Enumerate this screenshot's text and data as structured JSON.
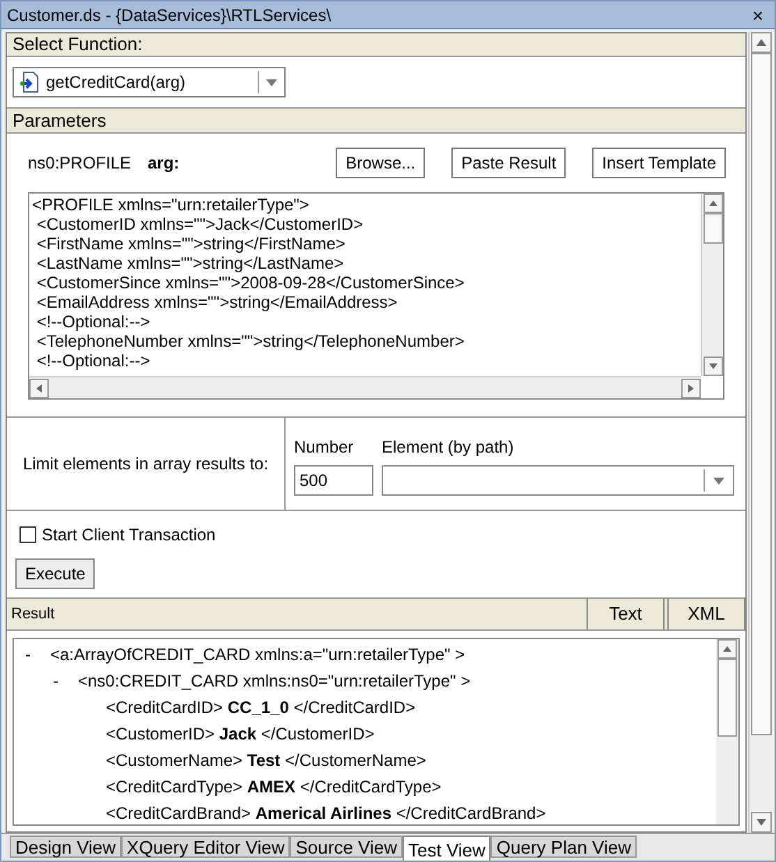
{
  "window": {
    "title": "Customer.ds - {DataServices}\\RTLServices\\",
    "close": "×"
  },
  "select_function": {
    "header": "Select Function:",
    "value": "getCreditCard(arg)"
  },
  "parameters": {
    "header": "Parameters",
    "type": "ns0:PROFILE",
    "name": "arg:",
    "buttons": [
      "Browse...",
      "Paste Result",
      "Insert Template"
    ],
    "lines": [
      "<PROFILE xmlns=\"urn:retailerType\">",
      " <CustomerID xmlns=\"\">Jack</CustomerID>",
      " <FirstName xmlns=\"\">string</FirstName>",
      " <LastName xmlns=\"\">string</LastName>",
      " <CustomerSince xmlns=\"\">2008-09-28</CustomerSince>",
      " <EmailAddress xmlns=\"\">string</EmailAddress>",
      " <!--Optional:-->",
      " <TelephoneNumber xmlns=\"\">string</TelephoneNumber>",
      " <!--Optional:-->"
    ]
  },
  "limit": {
    "label": "Limit elements in array results to:",
    "number_label": "Number",
    "number_value": "500",
    "element_label": "Element (by path)"
  },
  "start_client_transaction": {
    "label": "Start Client Transaction",
    "checked": false
  },
  "execute_button": "Execute",
  "result": {
    "header": "Result",
    "buttons": [
      {
        "label": "Text"
      },
      {
        "label": "XML"
      }
    ],
    "tree": [
      {
        "text": "<a:ArrayOfCREDIT_CARD xmlns:a=\"urn:retailerType\" >",
        "toggle": "-",
        "expanded": true,
        "children": [
          {
            "text": "<ns0:CREDIT_CARD xmlns:ns0=\"urn:retailerType\" >",
            "toggle": "-",
            "expanded": true,
            "children": [
              {
                "text": "<CreditCardID> **CC_1_0** </CreditCardID>"
              },
              {
                "text": "<CustomerID> **Jack** </CustomerID>"
              },
              {
                "text": "<CustomerName> **Test** </CustomerName>"
              },
              {
                "text": "<CreditCardType> **AMEX** </CreditCardType>"
              },
              {
                "text": "<CreditCardBrand> **Americal Airlines** </CreditCardBrand>"
              }
            ]
          }
        ]
      }
    ]
  },
  "tabs": [
    {
      "label": "Design View",
      "selected": false
    },
    {
      "label": "XQuery Editor View",
      "selected": false
    },
    {
      "label": "Source View",
      "selected": false
    },
    {
      "label": "Test View",
      "selected": true
    },
    {
      "label": "Query Plan View",
      "selected": false
    }
  ]
}
